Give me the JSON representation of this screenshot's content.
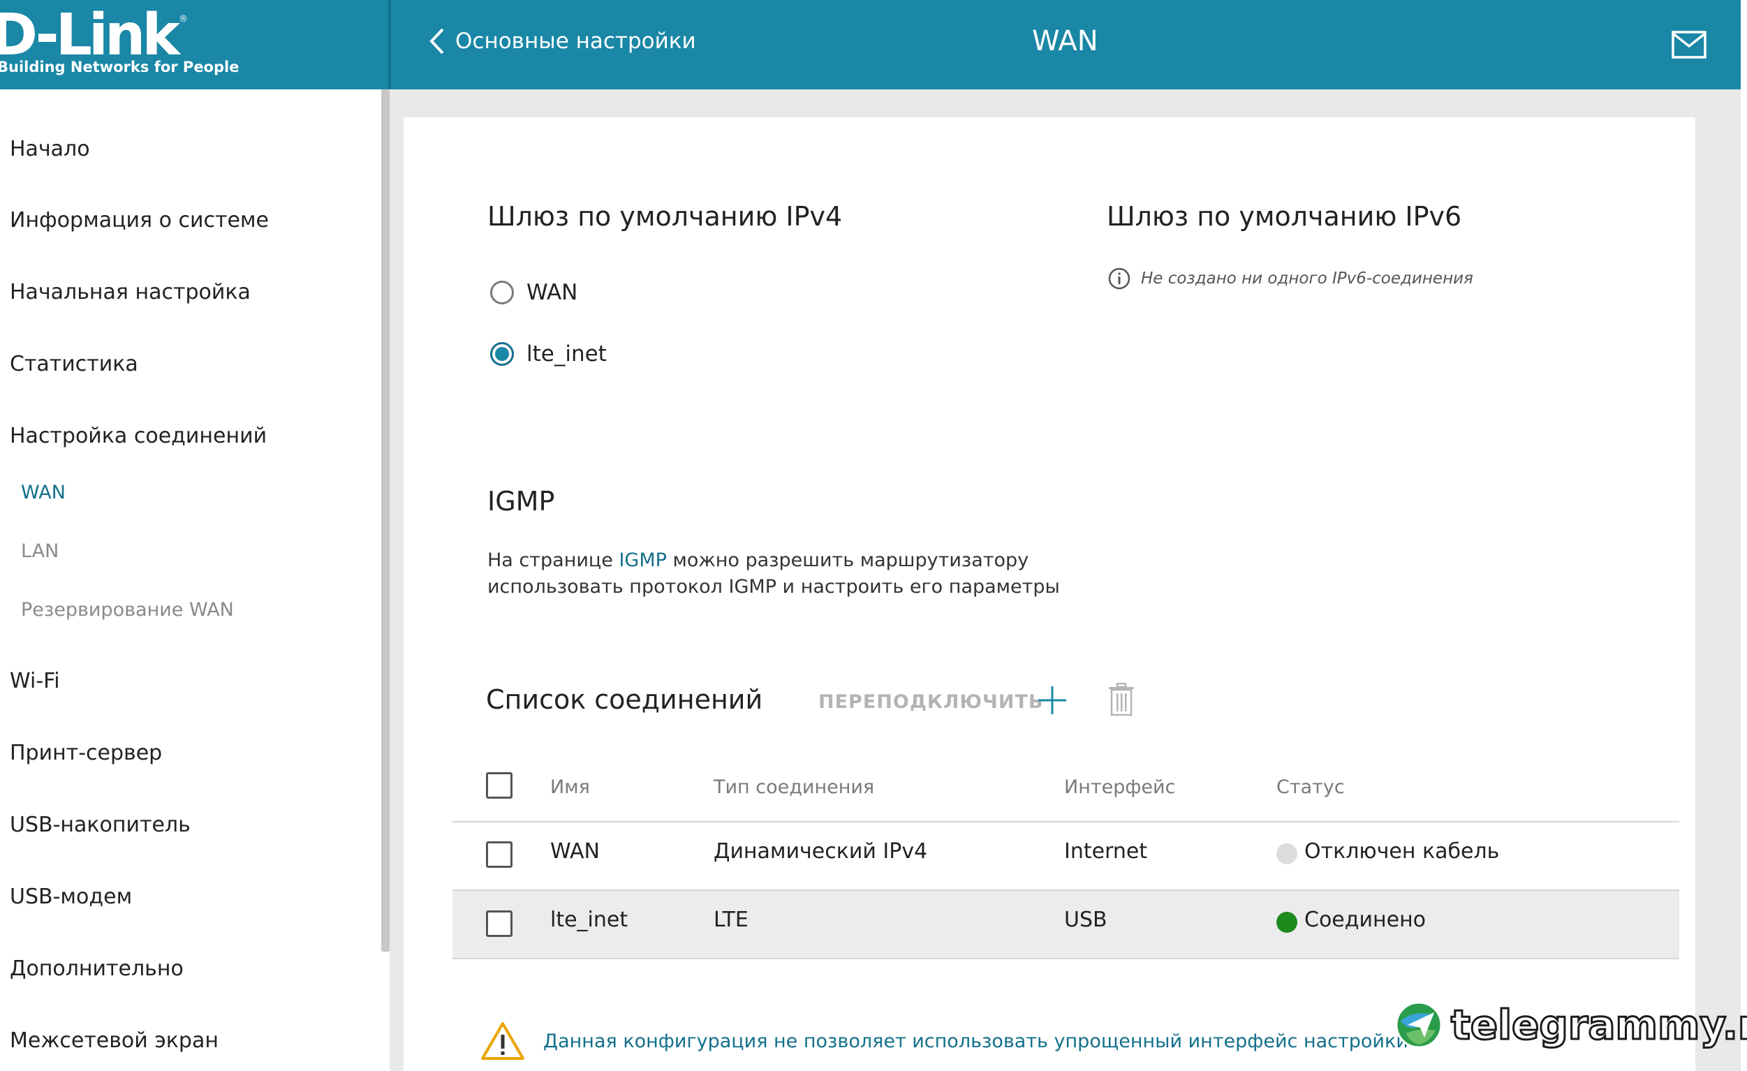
{
  "brand": {
    "logo": "D-Link",
    "registered": "®",
    "tagline": "Building Networks for People"
  },
  "header": {
    "back_label": "Основные настройки",
    "title": "WAN"
  },
  "sidebar": {
    "items": [
      {
        "label": "Начало"
      },
      {
        "label": "Информация о системе"
      },
      {
        "label": "Начальная настройка"
      },
      {
        "label": "Статистика"
      },
      {
        "label": "Настройка соединений"
      },
      {
        "label": "Wi-Fi"
      },
      {
        "label": "Принт-сервер"
      },
      {
        "label": "USB-накопитель"
      },
      {
        "label": "USB-модем"
      },
      {
        "label": "Дополнительно"
      },
      {
        "label": "Межсетевой экран"
      }
    ],
    "subitems": [
      {
        "label": "WAN",
        "active": true
      },
      {
        "label": "LAN",
        "active": false
      },
      {
        "label": "Резервирование WAN",
        "active": false
      }
    ]
  },
  "gateway_ipv4": {
    "title": "Шлюз по умолчанию IPv4",
    "options": [
      {
        "label": "WAN",
        "selected": false
      },
      {
        "label": "lte_inet",
        "selected": true
      }
    ]
  },
  "gateway_ipv6": {
    "title": "Шлюз по умолчанию IPv6",
    "note": "Не создано ни одного IPv6-соединения"
  },
  "igmp": {
    "title": "IGMP",
    "desc_before": "На странице ",
    "desc_link": "IGMP",
    "desc_after": " можно разрешить маршрутизатору использовать протокол IGMP и настроить его параметры"
  },
  "connections": {
    "title": "Список соединений",
    "reconnect_label": "ПЕРЕПОДКЛЮЧИТЬ",
    "headers": {
      "name": "Имя",
      "type": "Тип соединения",
      "interface": "Интерфейс",
      "status": "Статус"
    },
    "rows": [
      {
        "name": "WAN",
        "type": "Динамический IPv4",
        "interface": "Internet",
        "status": "Отключен кабель",
        "status_color": "#dcdcdc"
      },
      {
        "name": "lte_inet",
        "type": "LTE",
        "interface": "USB",
        "status": "Соединено",
        "status_color": "#1e8a1e"
      }
    ]
  },
  "warning": {
    "text": "Данная конфигурация не позволяет использовать упрощенный интерфейс настройки"
  },
  "watermark": {
    "text": "telegrammy.net"
  },
  "colors": {
    "header_bg": "#1a87a6",
    "accent": "#13708b",
    "warning": "#e9a400"
  }
}
